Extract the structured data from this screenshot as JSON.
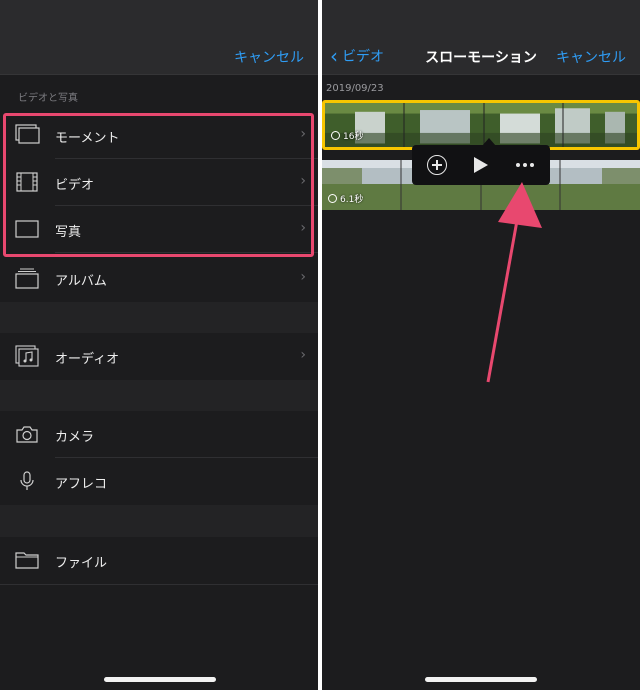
{
  "left": {
    "cancel_label": "キャンセル",
    "section_header": "ビデオと写真",
    "items": [
      {
        "label": "モーメント",
        "icon": "moments-icon"
      },
      {
        "label": "ビデオ",
        "icon": "film-icon"
      },
      {
        "label": "写真",
        "icon": "photo-icon"
      },
      {
        "label": "アルバム",
        "icon": "album-icon"
      },
      {
        "label": "オーディオ",
        "icon": "music-note-icon"
      },
      {
        "label": "カメラ",
        "icon": "camera-icon"
      },
      {
        "label": "アフレコ",
        "icon": "microphone-icon"
      },
      {
        "label": "ファイル",
        "icon": "folder-icon"
      }
    ]
  },
  "right": {
    "back_label": "ビデオ",
    "title": "スローモーション",
    "cancel_label": "キャンセル",
    "date": "2019/09/23",
    "clips": [
      {
        "duration": "16秒",
        "selected": true
      },
      {
        "duration": "6.1秒",
        "selected": false
      }
    ],
    "popup_actions": [
      "add",
      "play",
      "more"
    ]
  },
  "colors": {
    "accent": "#2f9df5",
    "highlight": "#e8486f",
    "selection": "#f7c600",
    "background": "#1c1c1e"
  }
}
